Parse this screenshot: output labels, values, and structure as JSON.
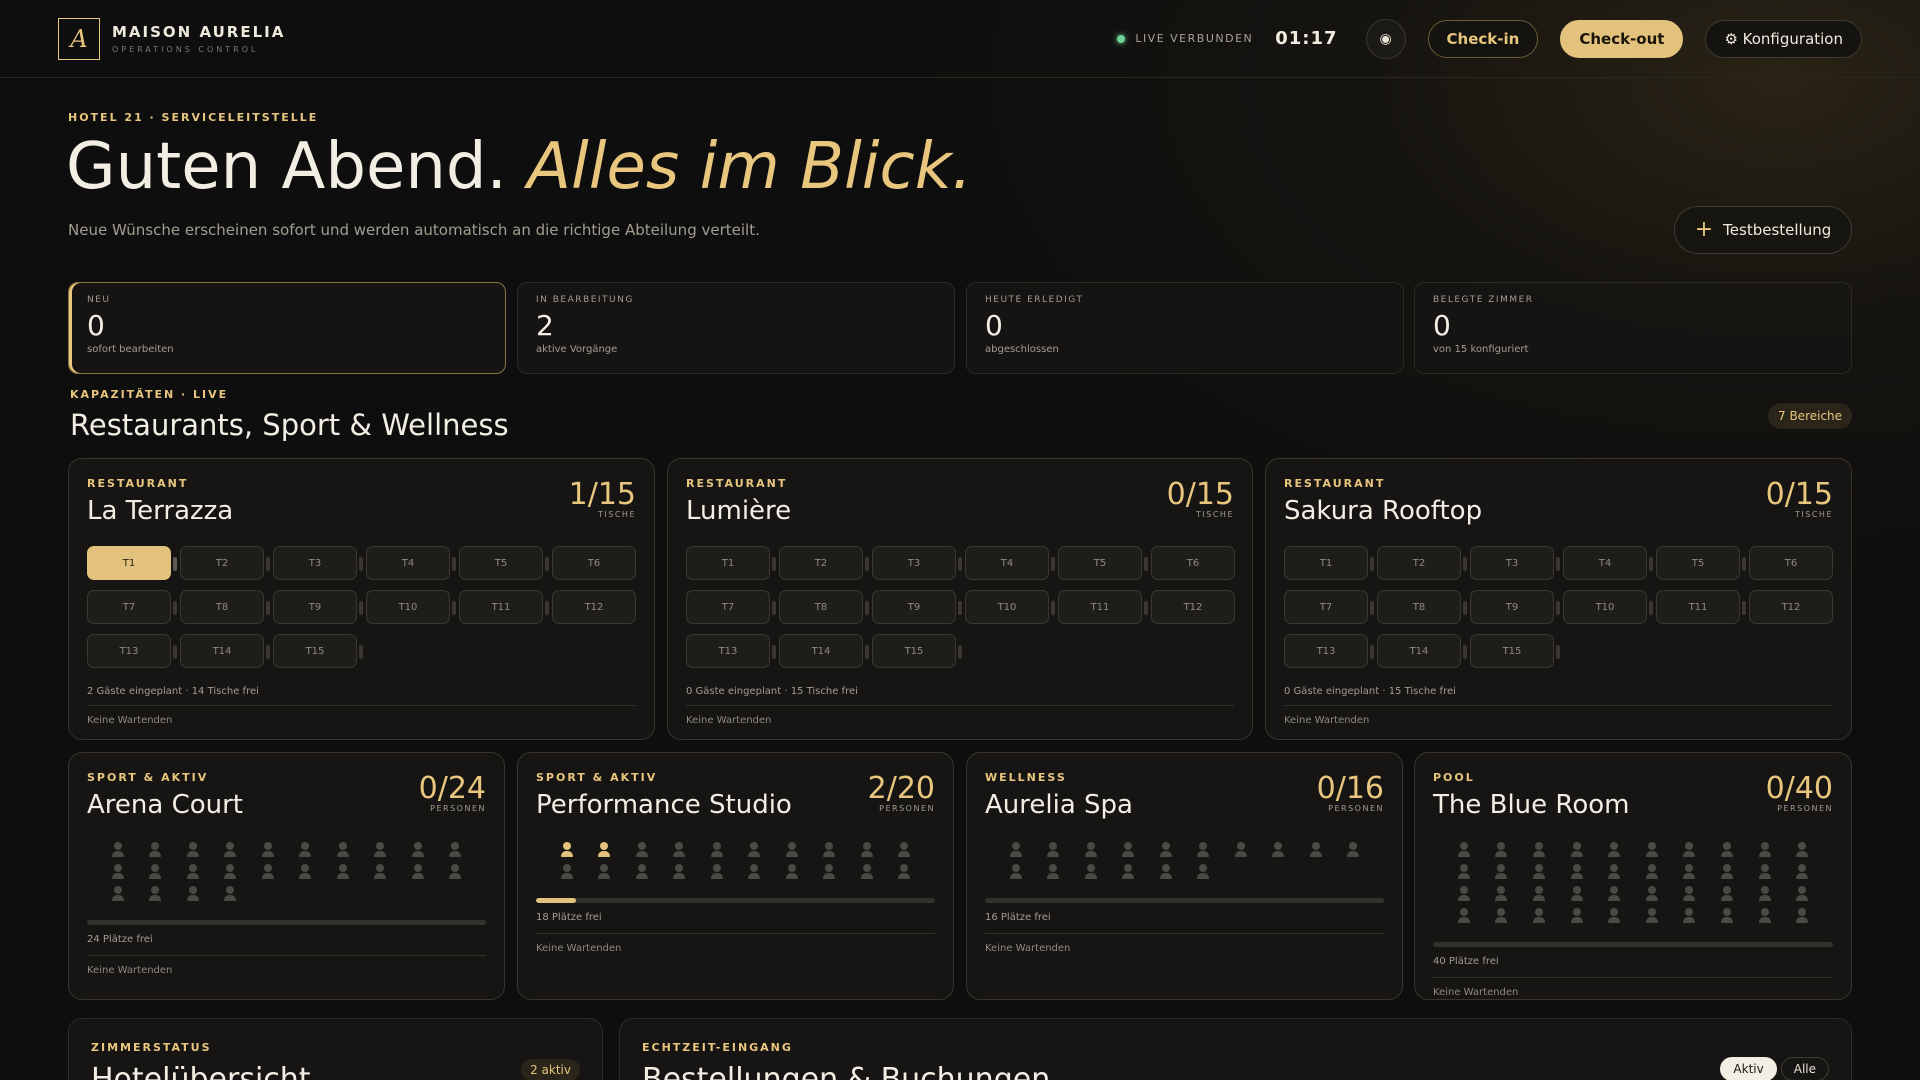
{
  "brand": {
    "logo": "A",
    "name": "MAISON AURELIA",
    "sub": "OPERATIONS CONTROL"
  },
  "header": {
    "live": "LIVE VERBUNDEN",
    "clock": "01:17",
    "theme_icon": "◉",
    "checkin": "Check-in",
    "checkout": "Check-out",
    "config": "⚙ Konfiguration"
  },
  "hero": {
    "eyebrow": "HOTEL 21 · SERVICELEITSTELLE",
    "title": "Guten Abend.",
    "title_accent": "Alles im Blick.",
    "subtitle": "Neue Wünsche erscheinen sofort und werden automatisch an die richtige Abteilung verteilt.",
    "test_button": "Testbestellung"
  },
  "stats": [
    {
      "label": "NEU",
      "value": "0",
      "note": "sofort bearbeiten"
    },
    {
      "label": "IN BEARBEITUNG",
      "value": "2",
      "note": "aktive Vorgänge"
    },
    {
      "label": "HEUTE ERLEDIGT",
      "value": "0",
      "note": "abgeschlossen"
    },
    {
      "label": "BELEGTE ZIMMER",
      "value": "0",
      "note": "von 15 konfiguriert"
    }
  ],
  "section": {
    "eyebrow": "KAPAZITÄTEN · LIVE",
    "title": "Restaurants, Sport & Wellness",
    "badge": "7 Bereiche"
  },
  "restaurants": [
    {
      "category": "RESTAURANT",
      "name": "La Terrazza",
      "count": "1/15",
      "unit": "TISCHE",
      "tables": [
        "T1",
        "T2",
        "T3",
        "T4",
        "T5",
        "T6",
        "T7",
        "T8",
        "T9",
        "T10",
        "T11",
        "T12",
        "T13",
        "T14",
        "T15"
      ],
      "occupied": [
        0
      ],
      "summary": "2 Gäste eingeplant · 14 Tische frei",
      "waiting": "Keine Wartenden"
    },
    {
      "category": "RESTAURANT",
      "name": "Lumière",
      "count": "0/15",
      "unit": "TISCHE",
      "tables": [
        "T1",
        "T2",
        "T3",
        "T4",
        "T5",
        "T6",
        "T7",
        "T8",
        "T9",
        "T10",
        "T11",
        "T12",
        "T13",
        "T14",
        "T15"
      ],
      "occupied": [],
      "summary": "0 Gäste eingeplant · 15 Tische frei",
      "waiting": "Keine Wartenden"
    },
    {
      "category": "RESTAURANT",
      "name": "Sakura Rooftop",
      "count": "0/15",
      "unit": "TISCHE",
      "tables": [
        "T1",
        "T2",
        "T3",
        "T4",
        "T5",
        "T6",
        "T7",
        "T8",
        "T9",
        "T10",
        "T11",
        "T12",
        "T13",
        "T14",
        "T15"
      ],
      "occupied": [],
      "summary": "0 Gäste eingeplant · 15 Tische frei",
      "waiting": "Keine Wartenden"
    }
  ],
  "spaces": [
    {
      "category": "SPORT & AKTIV",
      "name": "Arena Court",
      "count": "0/24",
      "unit": "PERSONEN",
      "capacity": 24,
      "occupied": 0,
      "free": "24 Plätze frei",
      "waiting": "Keine Wartenden"
    },
    {
      "category": "SPORT & AKTIV",
      "name": "Performance Studio",
      "count": "2/20",
      "unit": "PERSONEN",
      "capacity": 20,
      "occupied": 2,
      "free": "18 Plätze frei",
      "waiting": "Keine Wartenden"
    },
    {
      "category": "WELLNESS",
      "name": "Aurelia Spa",
      "count": "0/16",
      "unit": "PERSONEN",
      "capacity": 16,
      "occupied": 0,
      "free": "16 Plätze frei",
      "waiting": "Keine Wartenden"
    },
    {
      "category": "POOL",
      "name": "The Blue Room",
      "count": "0/40",
      "unit": "PERSONEN",
      "capacity": 40,
      "occupied": 0,
      "free": "40 Plätze frei",
      "waiting": "Keine Wartenden"
    }
  ],
  "rooms_panel": {
    "eyebrow": "ZIMMERSTATUS",
    "title": "Hotelübersicht",
    "badge": "2 aktiv"
  },
  "orders_panel": {
    "eyebrow": "ECHTZEIT-EINGANG",
    "title": "Bestellungen & Buchungen",
    "filter_active": "Aktiv",
    "filter_all": "Alle"
  }
}
